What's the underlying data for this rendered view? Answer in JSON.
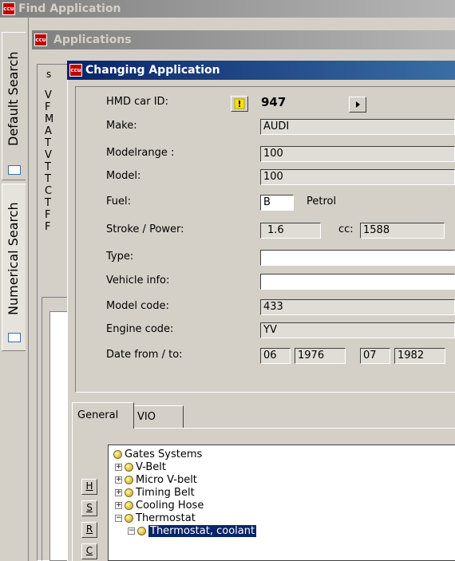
{
  "windows": {
    "find": {
      "title": "Find Application",
      "icon": "ccu-app-icon"
    },
    "applications": {
      "title": "Applications",
      "icon": "ccu-app-icon"
    },
    "changing": {
      "title": "Changing Application",
      "icon": "ccu-app-icon"
    }
  },
  "app_icon_text": "ccu",
  "side_tabs": [
    {
      "label": "Default Search",
      "icon": "search-tab-icon"
    },
    {
      "label": "Numerical Search",
      "icon": "numeric-tab-icon"
    }
  ],
  "list_column_letters": [
    "V",
    "F",
    "M",
    "A",
    "T",
    "V",
    "T",
    "T",
    "C",
    "T",
    "F",
    "F"
  ],
  "list_header_char": "s",
  "form": {
    "hmd_car_id": {
      "label": "HMD car ID:",
      "value": "947",
      "warning_icon": "warning-icon",
      "nav_icon": "arrow-right-icon"
    },
    "make": {
      "label": "Make:",
      "value": "AUDI"
    },
    "modelrange": {
      "label": "Modelrange :",
      "value": "100"
    },
    "model": {
      "label": "Model:",
      "value": "100"
    },
    "fuel": {
      "label": "Fuel:",
      "code": "B",
      "text": "Petrol"
    },
    "stroke_power": {
      "label": "Stroke / Power:",
      "stroke": "1.6",
      "cc_label": "cc:",
      "cc": "1588"
    },
    "type": {
      "label": "Type:",
      "value": ""
    },
    "vehicle_info": {
      "label": "Vehicle info:",
      "value": ""
    },
    "model_code": {
      "label": "Model code:",
      "value": "433"
    },
    "engine_code": {
      "label": "Engine code:",
      "value": "YV"
    },
    "date": {
      "label": "Date from / to:",
      "from_month": "06",
      "from_year": "1976",
      "to_month": "07",
      "to_year": "1982"
    }
  },
  "tabs": [
    {
      "label": "General",
      "active": true
    },
    {
      "label": "VIO",
      "active": false
    }
  ],
  "side_buttons": [
    "H",
    "S",
    "R",
    "C"
  ],
  "tree": [
    {
      "label": "Gates Systems",
      "level": 0,
      "expander": ""
    },
    {
      "label": "V-Belt",
      "level": 1,
      "expander": "+"
    },
    {
      "label": "Micro V-belt",
      "level": 1,
      "expander": "+"
    },
    {
      "label": "Timing Belt",
      "level": 1,
      "expander": "+"
    },
    {
      "label": "Cooling Hose",
      "level": 1,
      "expander": "+"
    },
    {
      "label": "Thermostat",
      "level": 1,
      "expander": "-"
    },
    {
      "label": "Thermostat, coolant",
      "level": 2,
      "expander": "-",
      "selected": true
    }
  ]
}
